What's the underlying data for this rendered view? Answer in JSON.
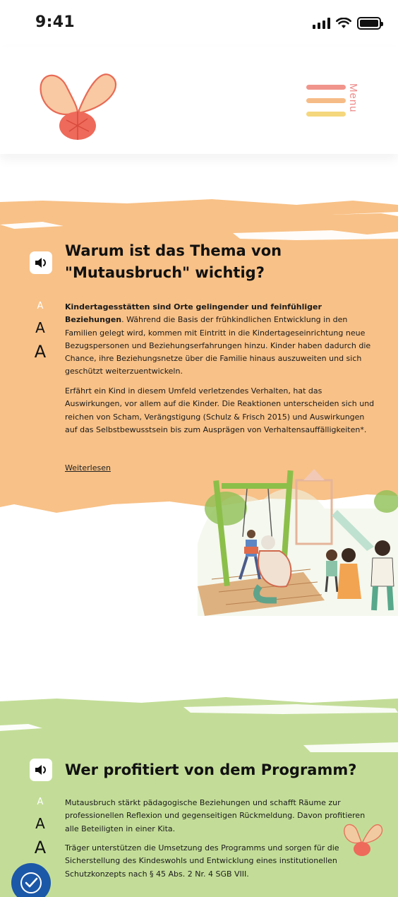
{
  "status_bar": {
    "time": "9:41"
  },
  "header": {
    "menu_label": "Menu",
    "menu_colors": [
      "#ef8a7f",
      "#f5b57a",
      "#f4d36f"
    ]
  },
  "colors": {
    "orange_bg": "#f8c187",
    "green_bg": "#c3dd98",
    "accent_blue": "#1c58a8"
  },
  "icons": {
    "speaker": "speaker-icon",
    "accessibility": "accessibility-icon",
    "logo": "butterfly-logo"
  },
  "font_size_controls": [
    "A",
    "A",
    "A"
  ],
  "section1": {
    "heading_line1": "Warum ist das Thema von",
    "heading_line2": "\"Mutausbruch\" wichtig?",
    "para1_bold": "Kindertagesstätten sind Orte gelingender und feinfühliger Beziehungen",
    "para1_rest": ". Während die Basis der frühkindlichen Entwicklung in den Familien gelegt wird, kommen mit Eintritt in die Kindertageseinrichtung neue Bezugspersonen und Beziehungserfahrungen hinzu. Kinder haben dadurch die Chance, ihre Beziehungsnetze über die Familie hinaus auszuweiten und sich geschützt weiterzuentwickeln.",
    "para2": "Erfährt ein Kind in diesem Umfeld verletzendes Verhalten, hat das Auswirkungen, vor allem auf die Kinder. Die Reaktionen unterscheiden sich und reichen von Scham, Verängstigung (Schulz & Frisch 2015) und Auswirkungen auf das Selbstbewusstsein bis zum Ausprägen von Verhaltensauffälligkeiten*.",
    "read_more": "Weiterlesen"
  },
  "section2": {
    "heading": "Wer profitiert von dem Programm?",
    "para1": "Mutausbruch stärkt pädagogische Beziehungen und schafft Räume zur professionellen Reflexion und gegenseitigen Rückmeldung. Davon profitieren alle Beteiligten in einer Kita.",
    "para2": "Träger unterstützen die Umsetzung des Programms und sorgen für die Sicherstellung des Kindeswohls und Entwicklung eines institutionellen Schutzkonzepts nach § 45 Abs. 2 Nr. 4 SGB VIII."
  }
}
